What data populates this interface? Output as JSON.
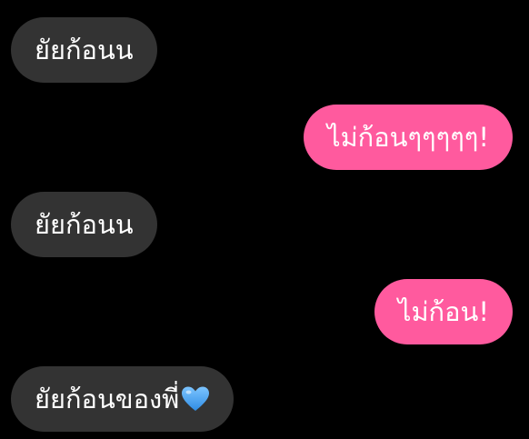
{
  "messages": [
    {
      "direction": "incoming",
      "text": "ยัยก้อนน"
    },
    {
      "direction": "outgoing",
      "text": "ไม่ก้อนๆๆๆๆๆ!"
    },
    {
      "direction": "incoming",
      "text": "ยัยก้อนน"
    },
    {
      "direction": "outgoing",
      "text": "ไม่ก้อน!"
    },
    {
      "direction": "incoming",
      "text": "ยัยก้อนของพี่",
      "emoji": "blue-heart-icon"
    }
  ],
  "colors": {
    "background": "#000000",
    "incoming_bubble": "#333333",
    "outgoing_bubble": "#ff5a9e",
    "text": "#ffffff",
    "heart": "#4aa8f5"
  }
}
